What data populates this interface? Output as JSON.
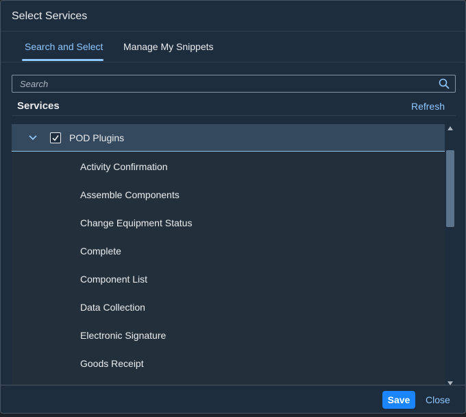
{
  "dialog": {
    "title": "Select Services"
  },
  "tabs": [
    {
      "label": "Search and Select",
      "selected": true
    },
    {
      "label": "Manage My Snippets",
      "selected": false
    }
  ],
  "search": {
    "placeholder": "Search",
    "icon": "search-icon"
  },
  "list": {
    "header": "Services",
    "refresh_label": "Refresh",
    "group": {
      "label": "POD Plugins",
      "checked": true,
      "expanded": true
    },
    "items": [
      "Activity Confirmation",
      "Assemble Components",
      "Change Equipment Status",
      "Complete",
      "Component List",
      "Data Collection",
      "Electronic Signature",
      "Goods Receipt"
    ]
  },
  "footer": {
    "save_label": "Save",
    "close_label": "Close"
  },
  "colors": {
    "accent": "#8fc7ff",
    "primary_button": "#1a85ff",
    "background": "#1d2d3e",
    "selected_row": "#34495e"
  }
}
